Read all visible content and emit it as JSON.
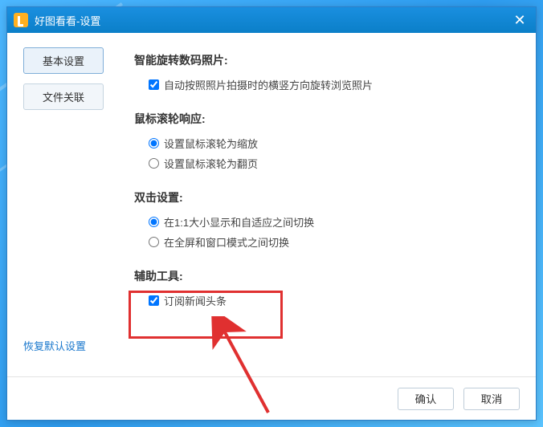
{
  "titlebar": {
    "text": "好图看看-设置"
  },
  "sidebar": {
    "basic": "基本设置",
    "assoc": "文件关联"
  },
  "restore": "恢复默认设置",
  "sections": {
    "rotate": {
      "title": "智能旋转数码照片:",
      "opt1": "自动按照照片拍摄时的横竖方向旋转浏览照片"
    },
    "wheel": {
      "title": "鼠标滚轮响应:",
      "opt1": "设置鼠标滚轮为缩放",
      "opt2": "设置鼠标滚轮为翻页"
    },
    "dblclick": {
      "title": "双击设置:",
      "opt1": "在1:1大小显示和自适应之间切换",
      "opt2": "在全屏和窗口模式之间切换"
    },
    "assist": {
      "title": "辅助工具:",
      "opt1": "订阅新闻头条"
    }
  },
  "footer": {
    "ok": "确认",
    "cancel": "取消"
  }
}
